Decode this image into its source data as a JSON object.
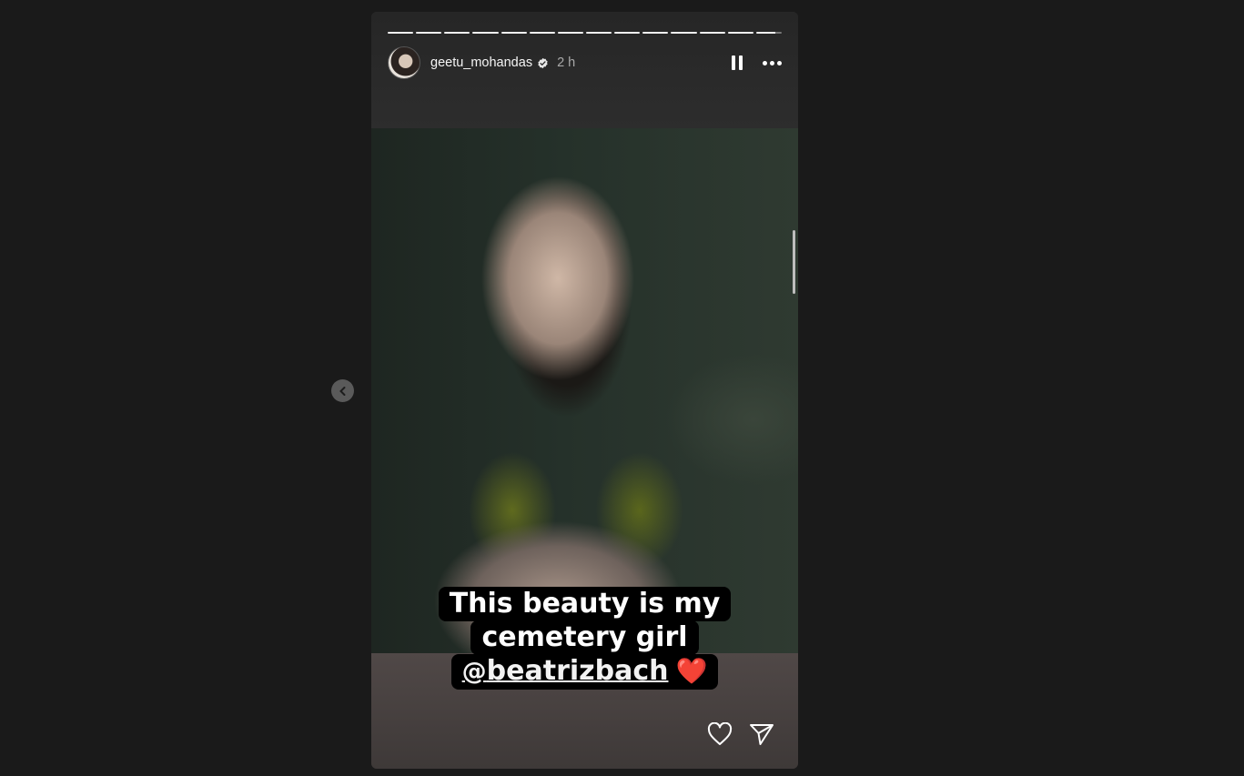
{
  "story": {
    "username": "geetu_mohandas",
    "time_ago": "2 h",
    "progress_segments": 14,
    "caption": {
      "line1": "This beauty is my",
      "line2": "cemetery girl",
      "mention_glyph": "@",
      "mention": "beatrizbach",
      "emoji": "❤️"
    }
  },
  "icons": {
    "verified": "verified-badge-icon",
    "pause": "pause-icon",
    "more": "more-options-icon",
    "like": "heart-icon",
    "share": "send-icon",
    "prev": "chevron-left-icon"
  },
  "colors": {
    "page_bg": "#1a1a1a",
    "caption_bg": "#000000",
    "heart": "#e3202f"
  }
}
